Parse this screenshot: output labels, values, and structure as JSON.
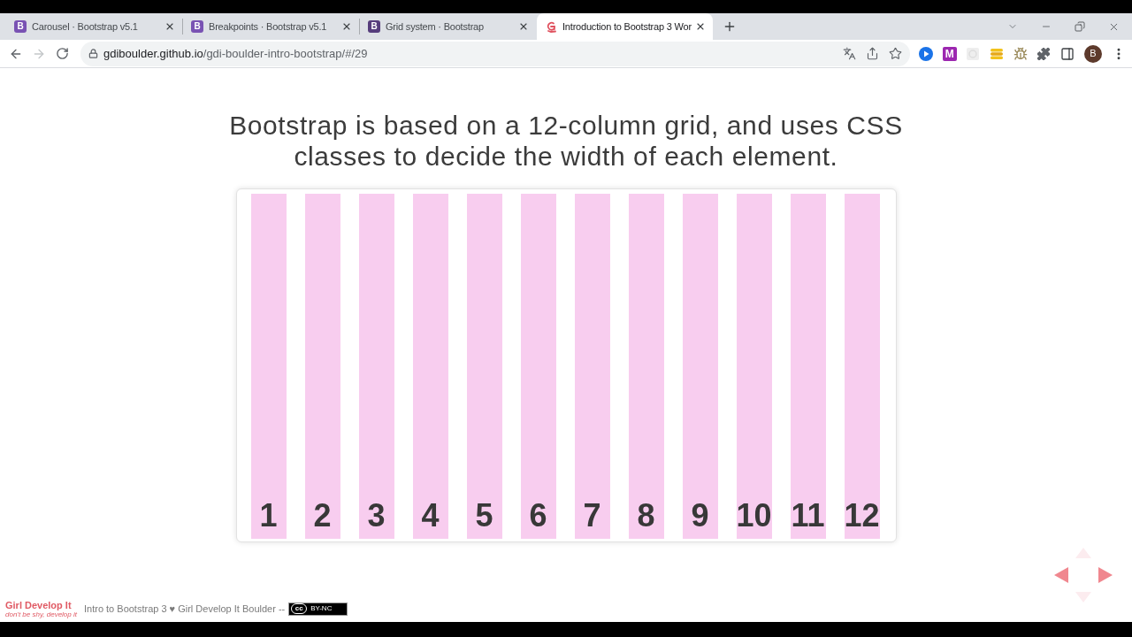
{
  "browser": {
    "tabs": [
      {
        "title": "Carousel · Bootstrap v5.1",
        "selected": false,
        "favicon": {
          "kind": "letter",
          "letter": "B",
          "color": "#7952b3"
        }
      },
      {
        "title": "Breakpoints · Bootstrap v5.1",
        "selected": false,
        "favicon": {
          "kind": "letter",
          "letter": "B",
          "color": "#7952b3"
        }
      },
      {
        "title": "Grid system · Bootstrap",
        "selected": false,
        "favicon": {
          "kind": "letter",
          "letter": "B",
          "color": "#563d7c"
        }
      },
      {
        "title": "Introduction to Bootstrap 3 Wor",
        "selected": true,
        "favicon": {
          "kind": "swirl"
        }
      }
    ],
    "forward_disabled": true,
    "address": {
      "host": "gdiboulder.github.io",
      "path": "/gdi-boulder-intro-bootstrap/#/29"
    },
    "extension_letter": "M",
    "profile_initial": "B"
  },
  "slide": {
    "heading": "Bootstrap is based on a 12-column grid, and uses CSS classes to decide the width of each element.",
    "columns": [
      "1",
      "2",
      "3",
      "4",
      "5",
      "6",
      "7",
      "8",
      "9",
      "10",
      "11",
      "12"
    ],
    "nav": [
      {
        "kind": "left",
        "enabled": true
      },
      {
        "kind": "right",
        "enabled": true
      },
      {
        "kind": "up",
        "enabled": false
      },
      {
        "kind": "down",
        "enabled": false
      }
    ]
  },
  "footer": {
    "logo": {
      "title": "Girl Develop It",
      "tagline": "don't be shy, develop it"
    },
    "text": "Intro to Bootstrap 3 ♥ Girl Develop It Boulder --",
    "license": {
      "symbol": "cc",
      "label": "BY-NC"
    }
  }
}
